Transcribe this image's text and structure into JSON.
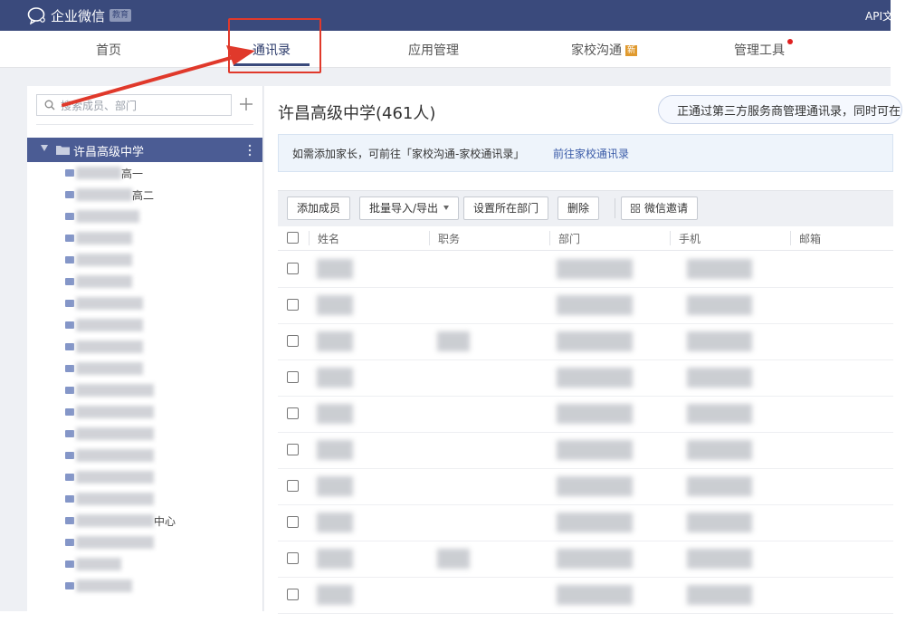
{
  "app": {
    "name": "企业微信",
    "edition_badge": "教育",
    "top_right_link": "API文"
  },
  "nav": {
    "items": [
      {
        "label": "首页"
      },
      {
        "label": "通讯录"
      },
      {
        "label": "应用管理"
      },
      {
        "label": "家校沟通",
        "badge": "新"
      },
      {
        "label": "管理工具"
      }
    ],
    "active_index": 1,
    "accent": "#3a4a7c"
  },
  "sidebar": {
    "search_placeholder": "搜索成员、部门",
    "root_label": "许昌高级中学",
    "tree_items": [
      {
        "label": "高一"
      },
      {
        "label": "高二"
      },
      {
        "label": ""
      },
      {
        "label": ""
      },
      {
        "label": ""
      },
      {
        "label": ""
      },
      {
        "label": ""
      },
      {
        "label": ""
      },
      {
        "label": ""
      },
      {
        "label": ""
      },
      {
        "label": ""
      },
      {
        "label": ""
      },
      {
        "label": ""
      },
      {
        "label": ""
      },
      {
        "label": ""
      },
      {
        "label": ""
      },
      {
        "label": "中心"
      },
      {
        "label": ""
      },
      {
        "label": ""
      },
      {
        "label": ""
      }
    ]
  },
  "main": {
    "title": "许昌高级中学(461人)",
    "notice_pill": "正通过第三方服务商管理通讯录，同时可在",
    "info_text": "如需添加家长，可前往「家校沟通-家校通讯录」",
    "info_link": "前往家校通讯录",
    "toolbar": {
      "add_member": "添加成员",
      "batch_import_export": "批量导入/导出",
      "set_department": "设置所在部门",
      "delete": "删除",
      "wechat_invite": "微信邀请"
    },
    "columns": [
      "姓名",
      "职务",
      "部门",
      "手机",
      "邮箱"
    ],
    "row_count": 10
  },
  "annotation": {
    "color": "#e0392b"
  }
}
